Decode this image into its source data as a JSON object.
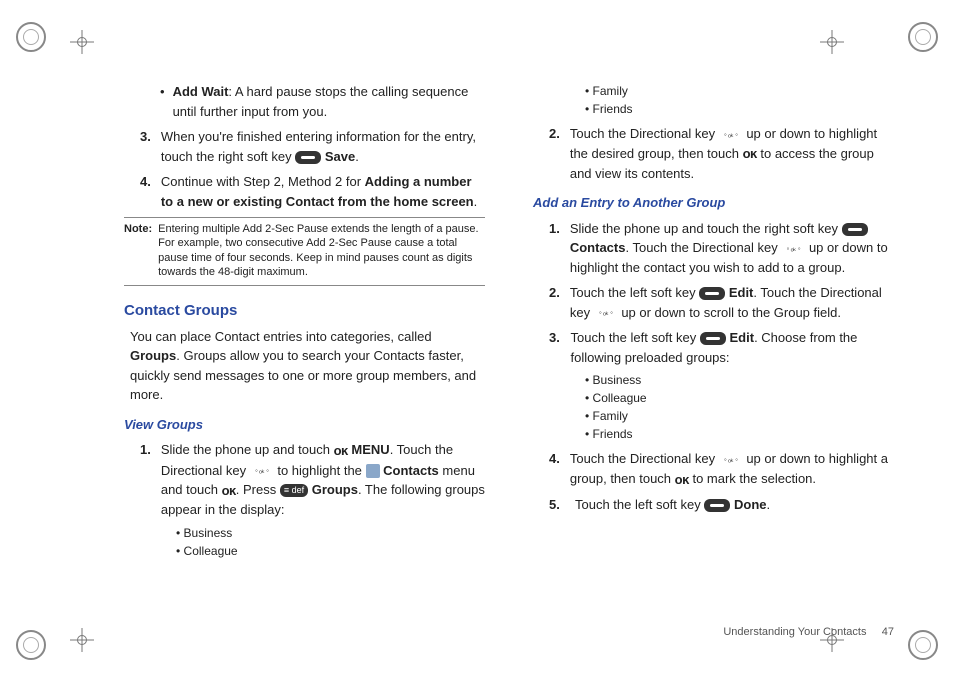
{
  "left": {
    "bullet1": {
      "label": "Add Wait",
      "text": ": A hard pause stops the calling sequence until further input from you."
    },
    "step3": {
      "num": "3.",
      "pre": "When you're finished entering information for the entry, touch the right soft key ",
      "save": "Save",
      "post": "."
    },
    "step4": {
      "num": "4.",
      "pre": "Continue with Step 2, Method 2 for ",
      "bold": "Adding a number to a new or existing Contact from the home screen",
      "post": "."
    },
    "note": {
      "label": "Note:",
      "text": "Entering multiple Add 2-Sec Pause extends the length of a pause. For example, two consecutive Add 2-Sec Pause cause a total pause time of four seconds. Keep in mind pauses count as digits towards the 48-digit maximum."
    },
    "sect": "Contact Groups",
    "sect_para_a": "You can place Contact entries into categories, called ",
    "sect_para_bold": "Groups",
    "sect_para_b": ". Groups allow you to search your Contacts faster, quickly send messages to one or more group members, and more.",
    "sub": "View Groups",
    "vg1": {
      "num": "1.",
      "a": "Slide the phone up and touch ",
      "menu": "MENU",
      "b": ". Touch the Directional key ",
      "c": " to highlight the ",
      "contacts": "Contacts",
      "d": " menu and touch ",
      "e": ". Press ",
      "groups": "Groups",
      "f": ". The following groups appear in the display:"
    },
    "list": [
      "Business",
      "Colleague"
    ]
  },
  "right": {
    "list_top": [
      "Family",
      "Friends"
    ],
    "step2": {
      "num": "2.",
      "a": "Touch the Directional key ",
      "b": " up or down to highlight the desired group, then touch ",
      "c": " to access the group and view its contents."
    },
    "sub": "Add an Entry to Another Group",
    "ae1": {
      "num": "1.",
      "a": "Slide the phone up and touch the right soft key ",
      "contacts": "Contacts",
      "b": ". Touch the Directional key ",
      "c": " up or down to highlight the contact you wish to add to a group."
    },
    "ae2": {
      "num": "2.",
      "a": "Touch the left soft key ",
      "edit": "Edit",
      "b": ". Touch the Directional key ",
      "c": " up or down to scroll to the Group field."
    },
    "ae3": {
      "num": "3.",
      "a": "Touch the left soft key ",
      "edit": "Edit",
      "b": ". Choose from the following preloaded groups:"
    },
    "list_groups": [
      "Business",
      "Colleague",
      "Family",
      "Friends"
    ],
    "ae4": {
      "num": "4.",
      "a": "Touch the Directional key ",
      "b": " up or down to highlight a group, then touch ",
      "c": " to mark the selection."
    },
    "ae5": {
      "num": "5.",
      "a": "Touch the left soft key ",
      "done": "Done",
      "b": "."
    }
  },
  "footer": {
    "section": "Understanding Your Contacts",
    "page": "47"
  }
}
